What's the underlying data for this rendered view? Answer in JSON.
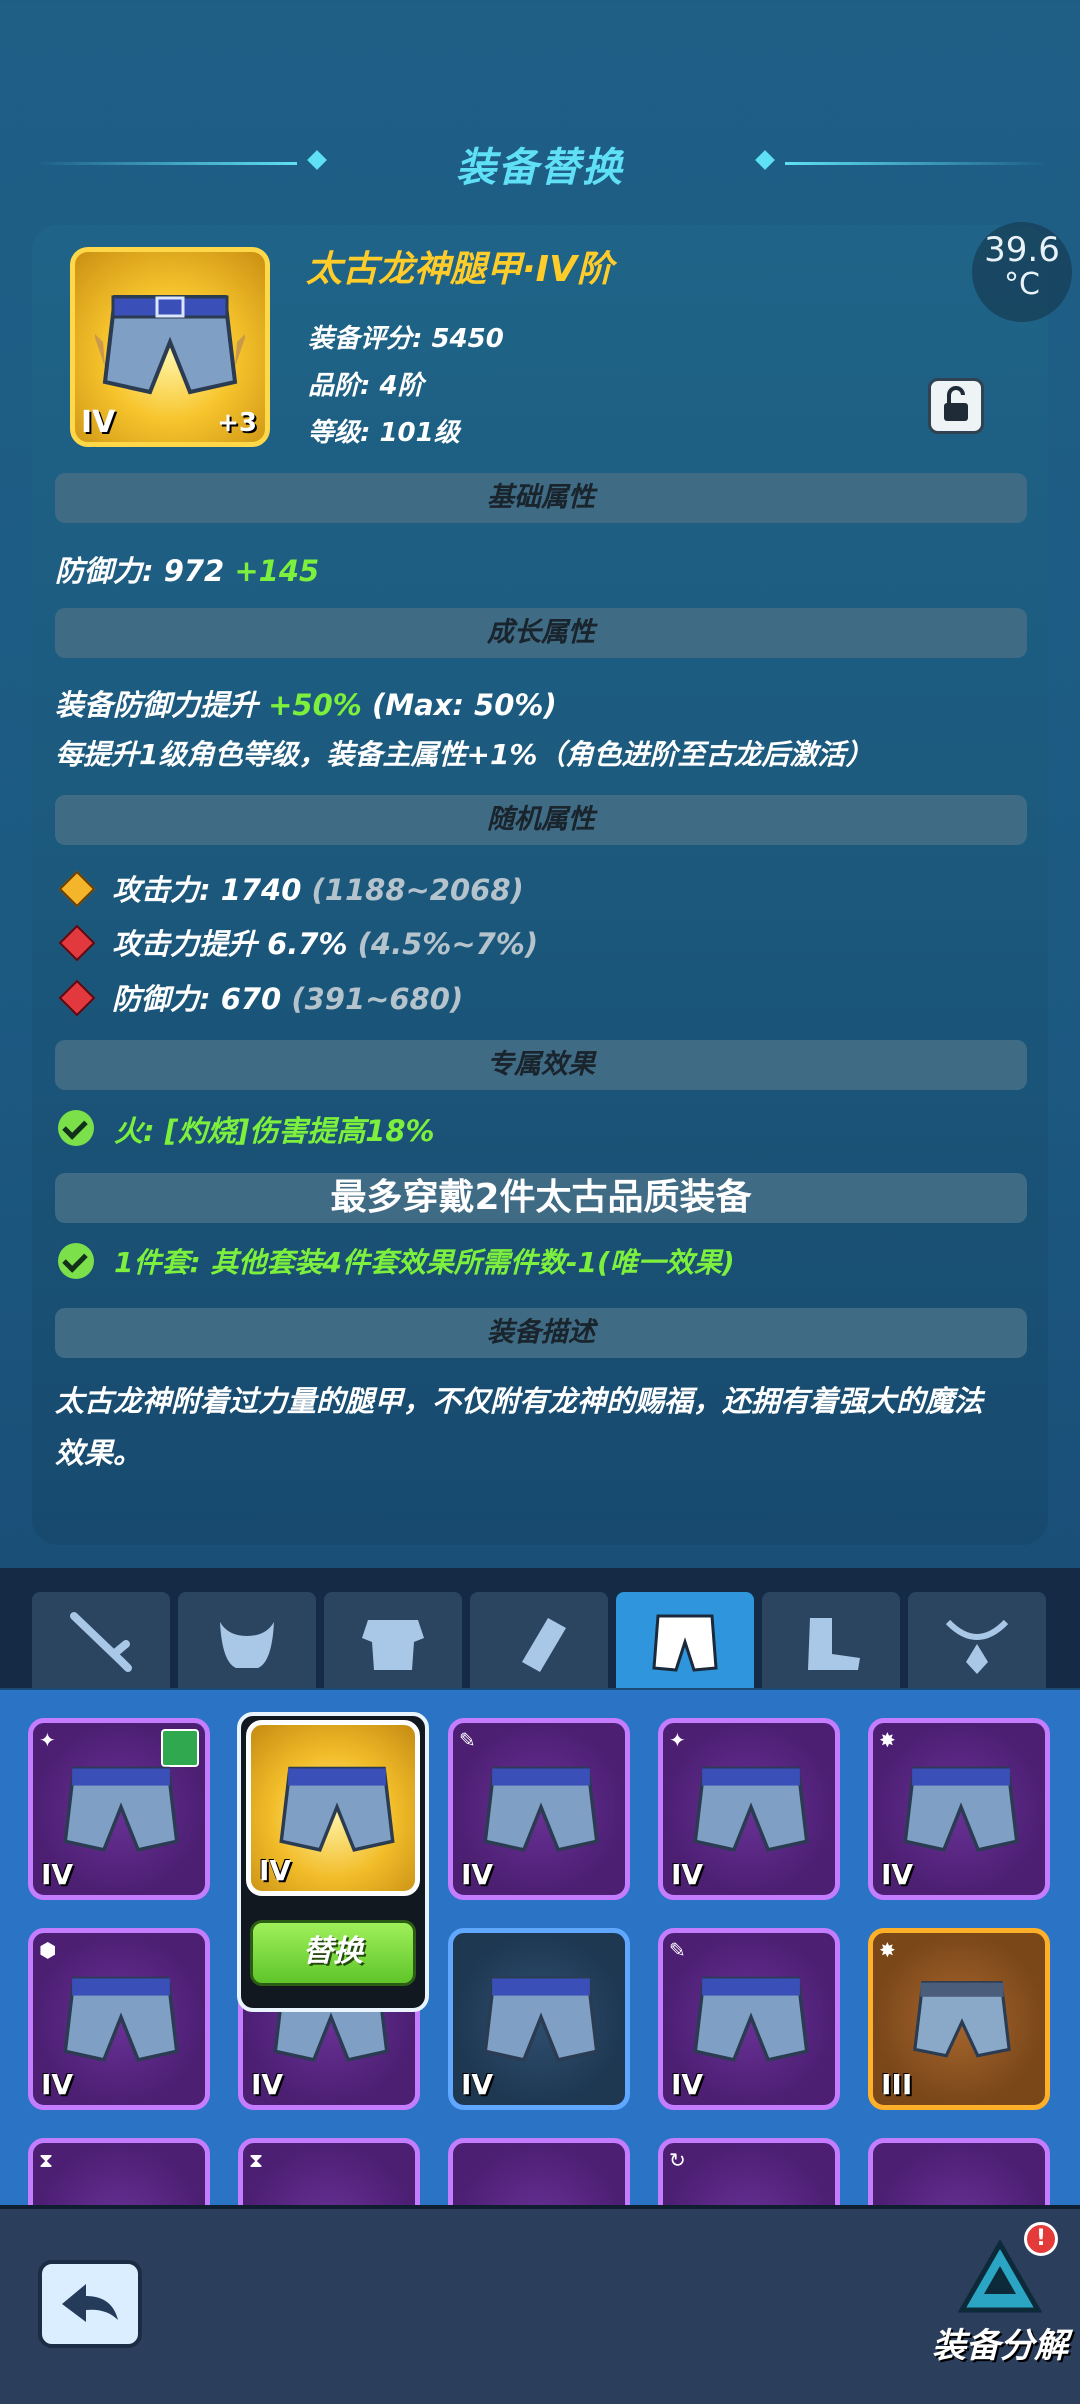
{
  "header": {
    "title": "装备替换"
  },
  "status": {
    "temperature_value": "39.6",
    "temperature_unit": "°C"
  },
  "item": {
    "name": "太古龙神腿甲·IV阶",
    "score": "装备评分: 5450",
    "grade": "品阶: 4阶",
    "level": "等级: 101级",
    "tier": "IV",
    "enhance": "+3"
  },
  "sections": {
    "base": "基础属性",
    "growth": "成长属性",
    "random": "随机属性",
    "exclusive": "专属效果",
    "set": "最多穿戴2件太古品质装备",
    "desc": "装备描述"
  },
  "base_attr": {
    "label": "防御力: 972",
    "bonus": "+145"
  },
  "growth_attr": {
    "line1_label": "装备防御力提升",
    "line1_value": "+50%",
    "line1_max": "(Max: 50%)",
    "line2": "每提升1级角色等级，装备主属性+1%（角色进阶至古龙后激活）"
  },
  "random_attrs": [
    {
      "label": "攻击力: 1740",
      "range": "(1188~2068)",
      "gem_color": "#f5b52a"
    },
    {
      "label": "攻击力提升 6.7%",
      "range": "(4.5%~7%)",
      "gem_color": "#e2393f"
    },
    {
      "label": "防御力: 670",
      "range": "(391~680)",
      "gem_color": "#e2393f"
    }
  ],
  "exclusive_effect": "火: [灼烧]伤害提高18%",
  "set_effect": "1件套: 其他套装4件套效果所需件数-1(唯一效果)",
  "description_line1": "太古龙神附着过力量的腿甲，不仅附有龙神的赐福，还拥有着强大的魔法",
  "description_line2": "效果。",
  "tabs": [
    {
      "icon": "sword-icon"
    },
    {
      "icon": "helmet-icon"
    },
    {
      "icon": "armor-icon"
    },
    {
      "icon": "bracer-icon"
    },
    {
      "icon": "pants-icon",
      "active": true
    },
    {
      "icon": "boots-icon"
    },
    {
      "icon": "amulet-icon"
    }
  ],
  "grid": {
    "row1": [
      {
        "tier": "IV",
        "frame": "purple"
      },
      {
        "tier": "IV",
        "frame": "gold"
      },
      {
        "tier": "IV",
        "frame": "purple"
      },
      {
        "tier": "IV",
        "frame": "purple"
      },
      {
        "tier": "IV",
        "frame": "purple"
      }
    ],
    "row2": [
      {
        "tier": "IV",
        "frame": "purple"
      },
      {
        "tier": "IV",
        "frame": "purple"
      },
      {
        "tier": "IV",
        "frame": "blue"
      },
      {
        "tier": "IV",
        "frame": "purple"
      },
      {
        "tier": "III",
        "frame": "orange"
      }
    ]
  },
  "replace_label": "替换",
  "bottom": {
    "dismantle_label": "装备分解",
    "alert": "!"
  },
  "colors": {
    "accent": "#5fe0f5",
    "gold": "#ffcc2a",
    "green": "#7cf03c",
    "tab_active": "#2f95dc"
  }
}
